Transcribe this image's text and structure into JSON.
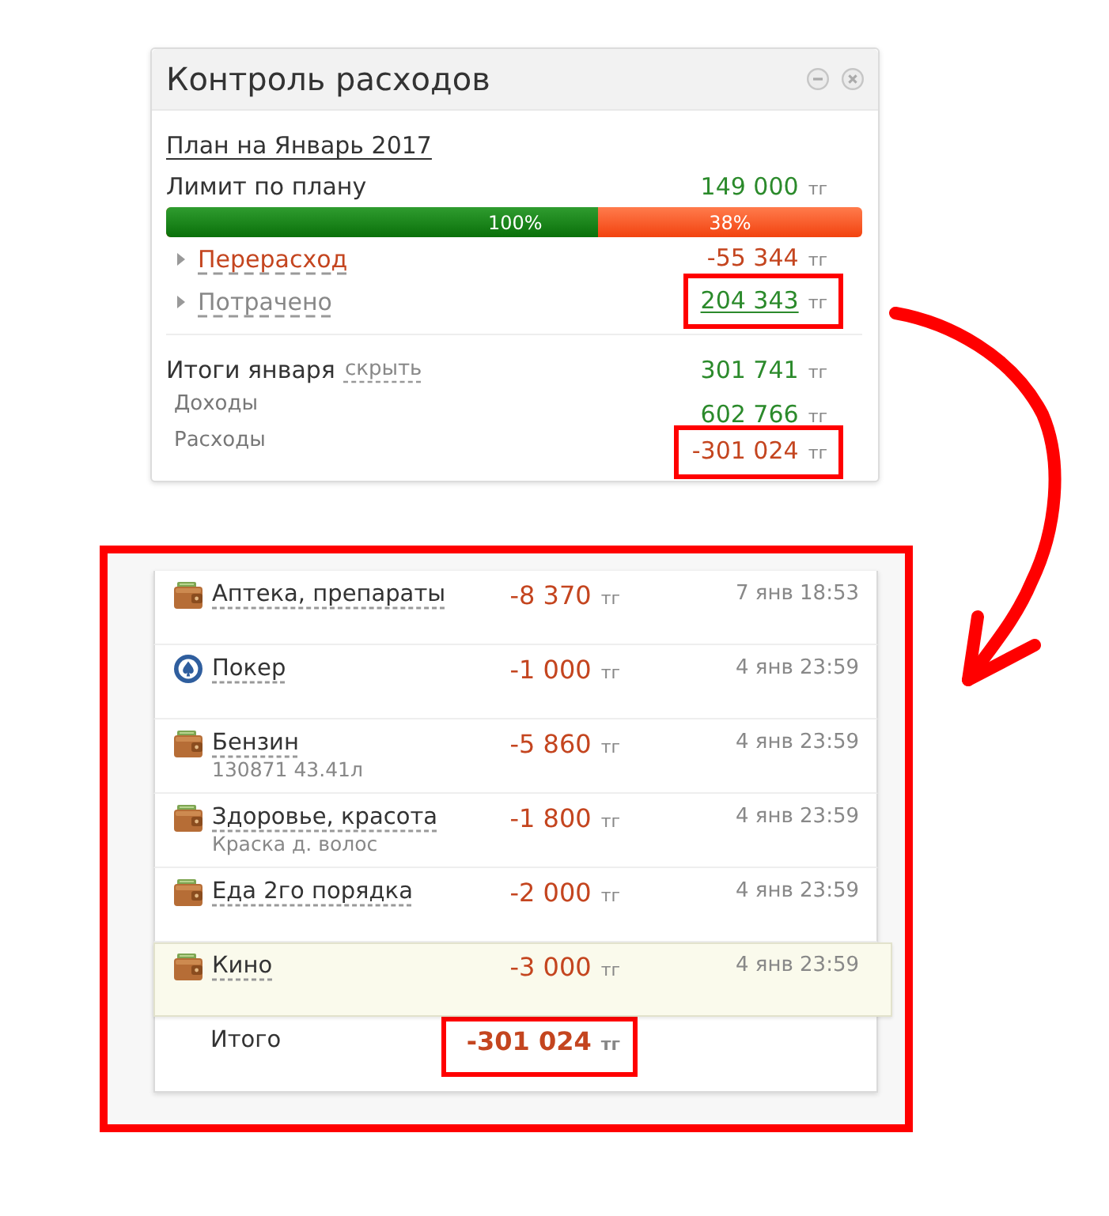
{
  "widget": {
    "title": "Контроль расходов",
    "plan_link": "План на Январь 2017",
    "limit": {
      "label": "Лимит по плану",
      "amount": "149 000",
      "currency": "тг"
    },
    "progress": {
      "level": 0.62,
      "fill_label": "100%",
      "rest_label": "38%"
    },
    "details": [
      {
        "kind": "overspend",
        "label": "Перерасход",
        "expanded": false,
        "amount": "-55 344",
        "currency": "тг",
        "highlighted": false
      },
      {
        "kind": "spent",
        "label": "Потрачено",
        "expanded": false,
        "amount": "204 343",
        "currency": "тг",
        "highlighted": true
      }
    ],
    "totals": {
      "label": "Итоги января",
      "toggle": "скрыть",
      "amount": "301 741",
      "currency": "тг"
    },
    "breakdown": [
      {
        "kind": "income",
        "label": "Доходы",
        "amount": "602 766",
        "currency": "тг",
        "highlighted": false
      },
      {
        "kind": "expense",
        "label": "Расходы",
        "amount": "-301 024",
        "currency": "тг",
        "highlighted": true
      }
    ]
  },
  "transactions": {
    "highlighted": true,
    "rows": [
      {
        "kind": "wallet",
        "name": "Аптека, препараты",
        "amount": "-8 370",
        "currency": "тг",
        "date": "7 янв 18:53",
        "selected": false
      },
      {
        "kind": "chip",
        "name": "Покер",
        "amount": "-1 000",
        "currency": "тг",
        "date": "4 янв 23:59",
        "selected": false
      },
      {
        "kind": "wallet",
        "name": "Бензин",
        "note": "130871 43.41л",
        "amount": "-5 860",
        "currency": "тг",
        "date": "4 янв 23:59",
        "selected": false
      },
      {
        "kind": "wallet",
        "name": "Здоровье, красота",
        "note": "Краска д. волос",
        "amount": "-1 800",
        "currency": "тг",
        "date": "4 янв 23:59",
        "selected": false
      },
      {
        "kind": "wallet",
        "name": "Еда 2го порядка",
        "amount": "-2 000",
        "currency": "тг",
        "date": "4 янв 23:59",
        "selected": false
      },
      {
        "kind": "wallet",
        "name": "Кино",
        "amount": "-3 000",
        "currency": "тг",
        "date": "4 янв 23:59",
        "selected": true
      }
    ],
    "total": {
      "label": "Итого",
      "amount": "-301 024",
      "currency": "тг",
      "highlighted": true
    }
  },
  "annotations": [
    {
      "kind": "arrow"
    }
  ]
}
